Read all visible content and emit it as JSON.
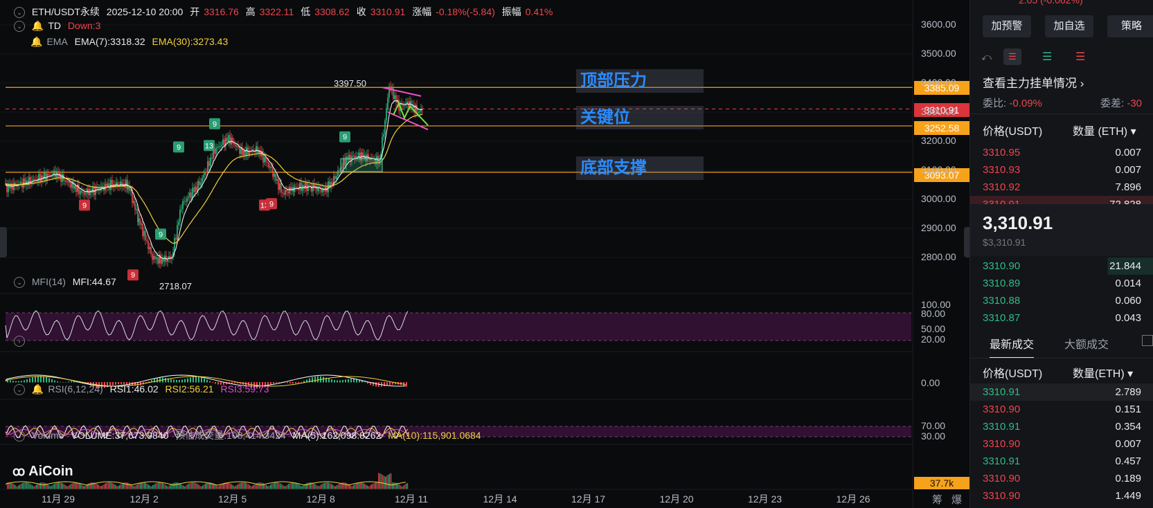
{
  "header": {
    "symbol": "ETH/USDT永续",
    "datetime": "2025-12-10 20:00",
    "open_label": "开",
    "open": "3316.76",
    "high_label": "高",
    "high": "3322.11",
    "low_label": "低",
    "low": "3308.62",
    "close_label": "收",
    "close": "3310.91",
    "change_label": "涨幅",
    "change": "-0.18%(-5.84)",
    "amp_label": "振幅",
    "amp": "0.41%"
  },
  "indicators": {
    "td_label": "TD",
    "td_value": "Down:3",
    "ema_label": "EMA",
    "ema7": "EMA(7):3318.32",
    "ema30": "EMA(30):3273.43",
    "mfi_label": "MFI(14)",
    "mfi_value": "MFI:44.67",
    "rsi_label": "RSI(6,12,24)",
    "rsi1": "RSI1:46.02",
    "rsi2": "RSI2:56.21",
    "rsi3": "RSI3:59.73",
    "vol_label": "Volume",
    "vol_value": "VOLUME:37,673.9840",
    "vol_est": "预估成交量:108,414.3424",
    "vol_ma5": "MA(5):162,098.8262",
    "vol_ma10": "MA(10):115,901.0684"
  },
  "zones": {
    "top": "顶部压力",
    "key": "关键位",
    "bottom": "底部支撑"
  },
  "price_tags": {
    "resistance": "3385.09",
    "current": "3310.91",
    "key": "3252.58",
    "support": "3093.07",
    "volume": "37.7k"
  },
  "annotations": {
    "high_mark": "3397.50",
    "low_mark": "2718.07",
    "td_counts": [
      "9",
      "9",
      "9",
      "9",
      "13",
      "9",
      "13",
      "9",
      "9",
      "13"
    ]
  },
  "y_axis": [
    "3600.00",
    "3500.00",
    "3400.00",
    "3300.00",
    "3200.00",
    "3100.00",
    "3000.00",
    "2900.00",
    "2800.00"
  ],
  "mfi_axis": [
    "100.00",
    "80.00",
    "50.00",
    "20.00"
  ],
  "macd_axis": [
    "0.00"
  ],
  "rsi_axis": [
    "70.00",
    "30.00"
  ],
  "x_axis": [
    "11月 29",
    "12月 2",
    "12月 5",
    "12月 8",
    "12月 11",
    "12月 14",
    "12月 17",
    "12月 20",
    "12月 23",
    "12月 26"
  ],
  "corner": {
    "left": "筹",
    "right": "爆"
  },
  "logo": "AiCoin",
  "side": {
    "top_partial": "2.05 (-0.062%)",
    "buttons": [
      "加预警",
      "加自选",
      "策略"
    ],
    "orderbook_link": "查看主力挂单情况",
    "ratio_label": "委比:",
    "ratio": "-0.09%",
    "diff_label": "委差:",
    "diff": "-30",
    "col_price": "价格(USDT)",
    "col_qty": "数量 (ETH)",
    "asks": [
      {
        "p": "3310.95",
        "q": "0.007"
      },
      {
        "p": "3310.93",
        "q": "0.007"
      },
      {
        "p": "3310.92",
        "q": "7.896"
      },
      {
        "p": "3310.91",
        "q": "72.828"
      }
    ],
    "last_price": "3,310.91",
    "last_usd": "$3,310.91",
    "bids": [
      {
        "p": "3310.90",
        "q": "21.844"
      },
      {
        "p": "3310.89",
        "q": "0.014"
      },
      {
        "p": "3310.88",
        "q": "0.060"
      },
      {
        "p": "3310.87",
        "q": "0.043"
      }
    ],
    "tab_trades": "最新成交",
    "tab_large": "大额成交",
    "trades_col_price": "价格(USDT)",
    "trades_col_qty": "数量(ETH)",
    "trades": [
      {
        "p": "3310.91",
        "q": "2.789",
        "side": "buy"
      },
      {
        "p": "3310.90",
        "q": "0.151",
        "side": "sell"
      },
      {
        "p": "3310.91",
        "q": "0.354",
        "side": "buy"
      },
      {
        "p": "3310.90",
        "q": "0.007",
        "side": "sell"
      },
      {
        "p": "3310.91",
        "q": "0.457",
        "side": "buy"
      },
      {
        "p": "3310.90",
        "q": "0.189",
        "side": "sell"
      },
      {
        "p": "3310.90",
        "q": "1.449",
        "side": "sell"
      }
    ]
  },
  "colors": {
    "up": "#2ebd85",
    "down": "#f0454b",
    "level": "#f7a21b",
    "ema7": "#ffffff",
    "ema30": "#f2d13c",
    "zone": "#2a8cff"
  }
}
